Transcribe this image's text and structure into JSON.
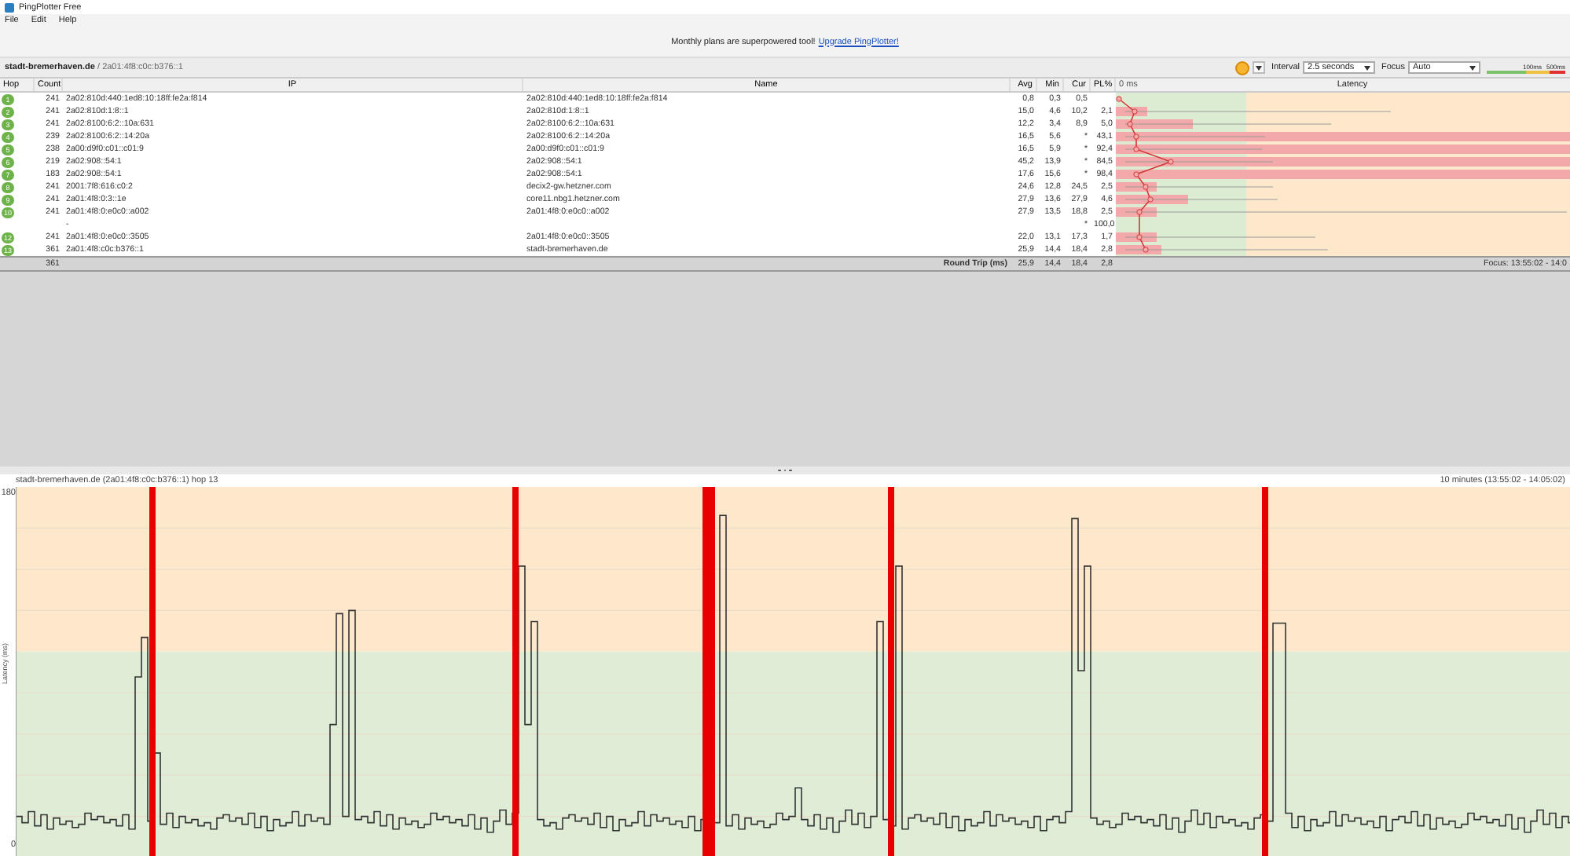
{
  "window": {
    "title": "PingPlotter Free"
  },
  "menu": [
    "File",
    "Edit",
    "Help"
  ],
  "banner": {
    "text": "Monthly plans are superpowered tool!",
    "link": "Upgrade PingPlotter!"
  },
  "target": {
    "host": "stadt-bremerhaven.de",
    "separator": "/",
    "address": "2a01:4f8:c0c:b376::1"
  },
  "toolbar": {
    "interval_label": "Interval",
    "interval": "2.5 seconds",
    "focus_label": "Focus",
    "focus": "Auto",
    "legend": [
      "100ms",
      "500ms"
    ]
  },
  "table": {
    "columns": [
      "Hop",
      "Count",
      "IP",
      "Name",
      "Avg",
      "Min",
      "Cur",
      "PL%"
    ],
    "latency_header": {
      "scale": "0 ms",
      "title": "Latency"
    },
    "rows": [
      {
        "hop": "1",
        "count": "241",
        "ip": "2a02:810d:440:1ed8:10:18ff:fe2a:f814",
        "name": "2a02:810d:440:1ed8:10:18ff:fe2a:f814",
        "avg": "0,8",
        "min": "0,3",
        "cur": "0,5"
      },
      {
        "hop": "2",
        "count": "241",
        "ip": "2a02:810d:1:8::1",
        "name": "2a02:810d:1:8::1",
        "avg": "15,0",
        "min": "4,6",
        "cur": "10,2",
        "pl": "2,1",
        "level": 0.07
      },
      {
        "hop": "3",
        "count": "241",
        "ip": "2a02:8100:6:2::10a:631",
        "name": "2a02:8100:6:2::10a:631",
        "avg": "12,2",
        "min": "3,4",
        "cur": "8,9",
        "pl": "5,0",
        "level": 0.17
      },
      {
        "hop": "4",
        "count": "239",
        "ip": "2a02:8100:6:2::14:20a",
        "name": "2a02:8100:6:2::14:20a",
        "avg": "16,5",
        "min": "5,6",
        "cur": "*",
        "pl": "43,1",
        "level": 1
      },
      {
        "hop": "5",
        "count": "238",
        "ip": "2a00:d9f0:c01::c01:9",
        "name": "2a00:d9f0:c01::c01:9",
        "avg": "16,5",
        "min": "5,9",
        "cur": "*",
        "pl": "92,4",
        "level": 1
      },
      {
        "hop": "6",
        "count": "219",
        "ip": "2a02:908::54:1",
        "name": "2a02:908::54:1",
        "avg": "45,2",
        "min": "13,9",
        "cur": "*",
        "pl": "84,5",
        "level": 1
      },
      {
        "hop": "7",
        "count": "183",
        "ip": "2a02:908::54:1",
        "name": "2a02:908::54:1",
        "avg": "17,6",
        "min": "15,6",
        "cur": "*",
        "pl": "98,4",
        "level": 1
      },
      {
        "hop": "8",
        "count": "241",
        "ip": "2001:7f8:616:c0:2",
        "name": "decix2-gw.hetzner.com",
        "avg": "24,6",
        "min": "12,8",
        "cur": "24,5",
        "pl": "2,5",
        "level": 0.09
      },
      {
        "hop": "9",
        "count": "241",
        "ip": "2a01:4f8:0:3::1e",
        "name": "core11.nbg1.hetzner.com",
        "avg": "27,9",
        "min": "13,6",
        "cur": "27,9",
        "pl": "4,6",
        "level": 0.16
      },
      {
        "hop": "10",
        "count": "241",
        "ip": "2a01:4f8:0:e0c0::a002",
        "name": "2a01:4f8:0:e0c0::a002",
        "avg": "27,9",
        "min": "13,5",
        "cur": "18,8",
        "pl": "2,5",
        "level": 0.09
      },
      {
        "ip": "-",
        "cur": "*",
        "pl": "100,0"
      },
      {
        "hop": "12",
        "count": "241",
        "ip": "2a01:4f8:0:e0c0::3505",
        "name": "2a01:4f8:0:e0c0::3505",
        "avg": "22,0",
        "min": "13,1",
        "cur": "17,3",
        "pl": "1,7",
        "level": 0.09
      },
      {
        "hop": "13",
        "count": "361",
        "ip": "2a01:4f8:c0c:b376::1",
        "name": "stadt-bremerhaven.de",
        "avg": "25,9",
        "min": "14,4",
        "cur": "18,4",
        "pl": "2,8",
        "level": 0.1
      }
    ],
    "footer": {
      "count": "361",
      "label": "Round Trip (ms)",
      "avg": "25,9",
      "min": "14,4",
      "cur": "18,4",
      "pl": "2,8",
      "focus": "Focus: 13:55:02 - 14:0"
    }
  },
  "graph": {
    "title": "stadt-bremerhaven.de (2a01:4f8:c0c:b376::1) hop 13",
    "range": "10 minutes (13:55:02 - 14:05:02)",
    "ylabel": "Latency (ms)",
    "ymax": "180",
    "ymin": "0"
  }
}
